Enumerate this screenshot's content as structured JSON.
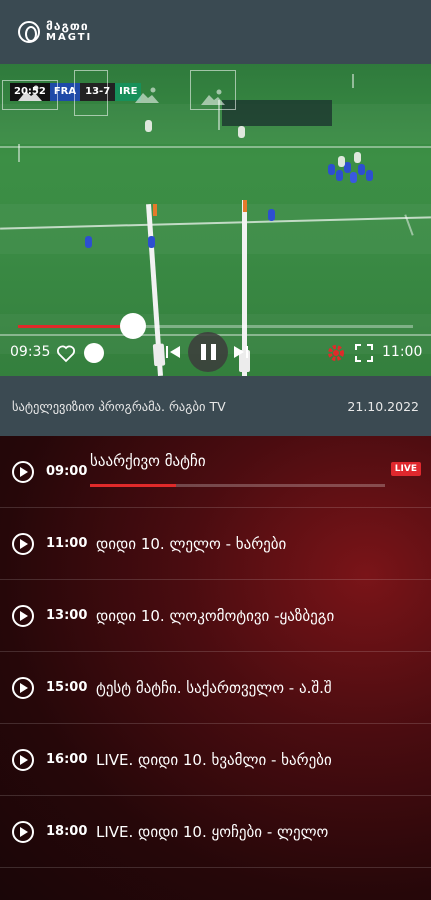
{
  "header": {
    "logo_line1": "მაგთი",
    "logo_line2": "MAGTI"
  },
  "video": {
    "scorebug": {
      "clock": "20:52",
      "team_home": "FRA",
      "score": "13-7",
      "team_away": "IRE"
    },
    "elapsed": "09:35",
    "end_time": "11:00",
    "progress_fraction": 0.29
  },
  "info_bar": {
    "title": "სატელევიზიო პროგრამა. რაგბი TV",
    "date": "21.10.2022"
  },
  "programs": [
    {
      "time": "09:00",
      "title": "საარქივო მატჩი",
      "current": true,
      "live_label": "LIVE",
      "progress_fraction": 0.29
    },
    {
      "time": "11:00",
      "title": "დიდი 10. ლელო - ხარები"
    },
    {
      "time": "13:00",
      "title": "დიდი 10. ლოკომოტივი -ყაზბეგი"
    },
    {
      "time": "15:00",
      "title": "ტესტ მატჩი. საქართველო - ა.შ.შ"
    },
    {
      "time": "16:00",
      "title": "LIVE. დიდი 10. ხვამლი - ხარები"
    },
    {
      "time": "18:00",
      "title": "LIVE. დიდი 10. ყოჩები - ლელო"
    }
  ],
  "colors": {
    "accent_red": "#e02a2a",
    "header_bg": "#3a4a52",
    "list_bg": "#4a0c10"
  }
}
